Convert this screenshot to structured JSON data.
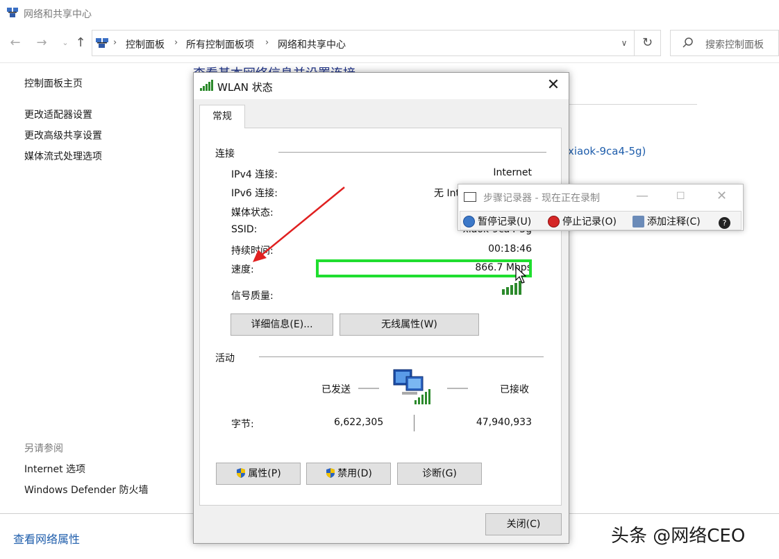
{
  "window": {
    "title": "网络和共享中心"
  },
  "address": {
    "crumbs": [
      "控制面板",
      "所有控制面板项",
      "网络和共享中心"
    ],
    "search_placeholder": "搜索控制面板"
  },
  "left_nav": {
    "home": "控制面板主页",
    "items": [
      "更改适配器设置",
      "更改高级共享设置",
      "媒体流式处理选项"
    ],
    "see_also_title": "另请参阅",
    "see_also": [
      "Internet 选项",
      "Windows Defender 防火墙"
    ]
  },
  "main": {
    "heading": "查看基本网络信息并设置连接",
    "network_link": "xiaok-9ca4-5g)",
    "bottom_link": "查看网络属性"
  },
  "dialog": {
    "title": "WLAN 状态",
    "tab": "常规",
    "connection_label": "连接",
    "rows": [
      {
        "label": "IPv4 连接:",
        "value": "Internet"
      },
      {
        "label": "IPv6 连接:",
        "value": "无 Int"
      },
      {
        "label": "媒体状态:",
        "value": ""
      },
      {
        "label": "SSID:",
        "value": "xiaok-9ca4-5g"
      },
      {
        "label": "持续时间:",
        "value": "00:18:46"
      },
      {
        "label": "速度:",
        "value": "866.7 Mbps"
      },
      {
        "label": "信号质量:",
        "value": ""
      }
    ],
    "details_button": "详细信息(E)...",
    "wireless_button": "无线属性(W)",
    "activity_label": "活动",
    "sent_label": "已发送",
    "received_label": "已接收",
    "bytes_label": "字节:",
    "bytes_sent": "6,622,305",
    "bytes_received": "47,940,933",
    "properties_button": "属性(P)",
    "disable_button": "禁用(D)",
    "diagnose_button": "诊断(G)",
    "close_button": "关闭(C)",
    "signal_bars": 5
  },
  "steps_recorder": {
    "title": "步骤记录器 - 现在正在录制",
    "pause": "暂停记录(U)",
    "stop": "停止记录(O)",
    "add_comment": "添加注释(C)"
  },
  "watermark": "头条 @网络CEO",
  "colors": {
    "highlight": "#1fde2f",
    "arrow": "#e02020",
    "link": "#1e5dab"
  }
}
